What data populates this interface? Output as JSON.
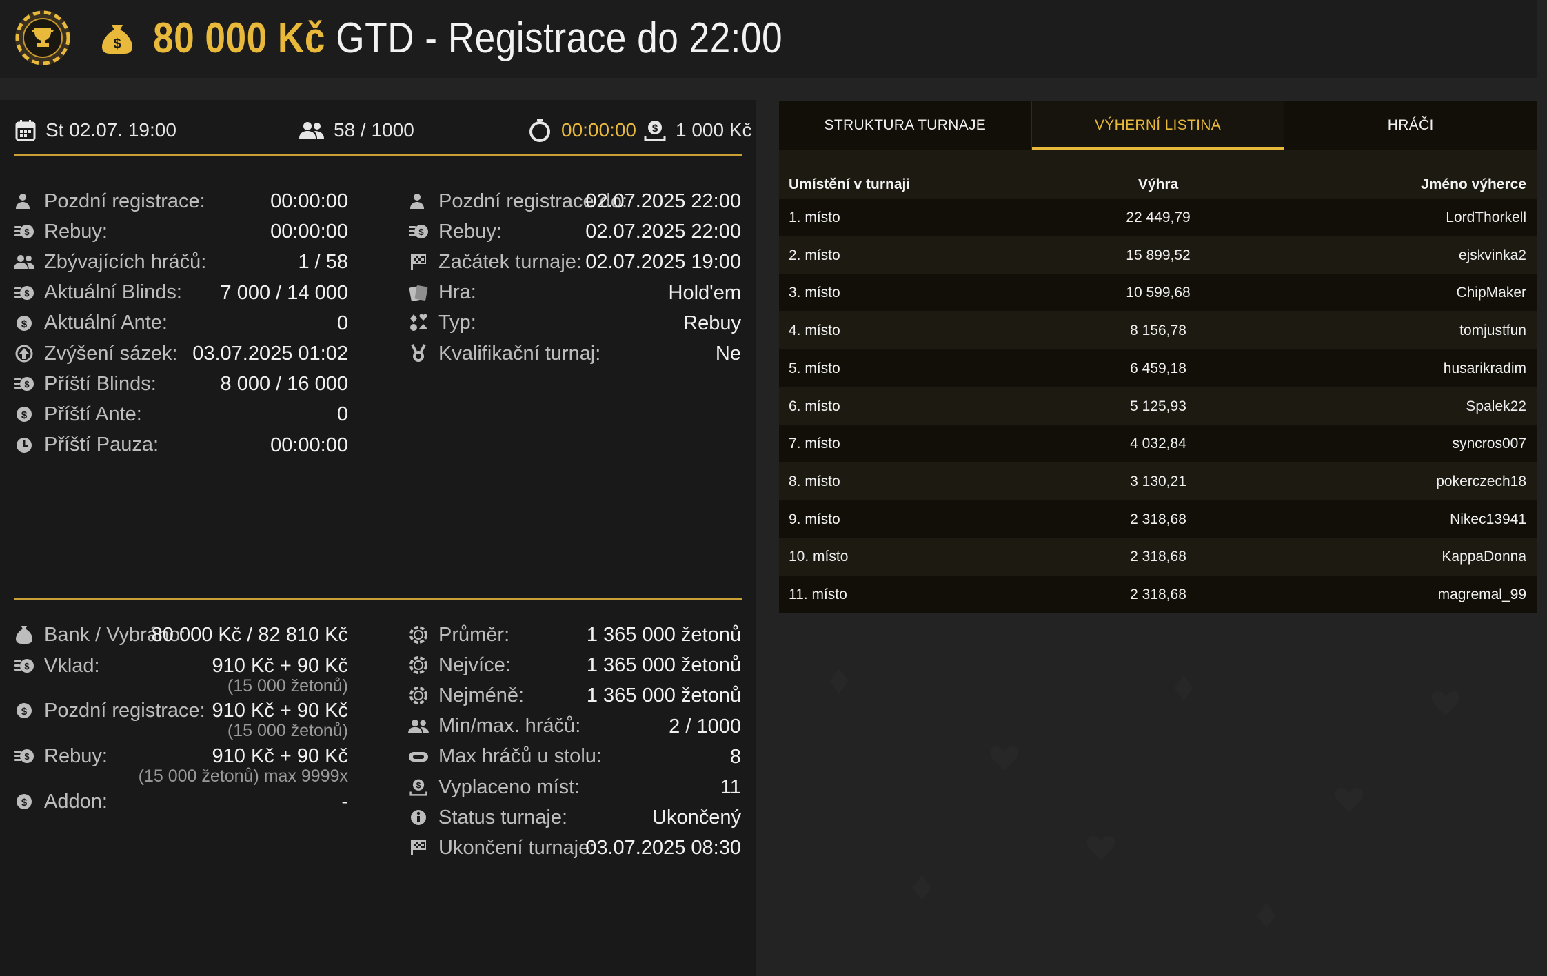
{
  "header": {
    "amount": "80 000 Kč",
    "title_rest": "GTD - Registrace do 22:00"
  },
  "summary": {
    "date": "St 02.07. 19:00",
    "players": "58 / 1000",
    "timer": "00:00:00",
    "buyin": "1 000 Kč"
  },
  "left_col": [
    {
      "icon": "user-clock-icon",
      "label": "Pozdní registrace:",
      "value": "00:00:00"
    },
    {
      "icon": "coins-icon",
      "label": "Rebuy:",
      "value": "00:00:00"
    },
    {
      "icon": "users-icon",
      "label": "Zbývajících hráčů:",
      "value": "1 / 58"
    },
    {
      "icon": "coins-icon",
      "label": "Aktuální Blinds:",
      "value": "7 000 / 14 000"
    },
    {
      "icon": "dollar-coin-icon",
      "label": "Aktuální Ante:",
      "value": "0"
    },
    {
      "icon": "arrow-up-circle-icon",
      "label": "Zvýšení sázek:",
      "value": "03.07.2025 01:02"
    },
    {
      "icon": "coins-icon",
      "label": "Příští Blinds:",
      "value": "8 000 / 16 000"
    },
    {
      "icon": "dollar-coin-icon",
      "label": "Příští Ante:",
      "value": "0"
    },
    {
      "icon": "clock-icon",
      "label": "Příští Pauza:",
      "value": "00:00:00"
    }
  ],
  "right_col": [
    {
      "icon": "user-clock-icon",
      "label": "Pozdní registrace do:",
      "value": "02.07.2025 22:00"
    },
    {
      "icon": "coins-icon",
      "label": "Rebuy:",
      "value": "02.07.2025 22:00"
    },
    {
      "icon": "flag-icon",
      "label": "Začátek turnaje:",
      "value": "02.07.2025 19:00"
    },
    {
      "icon": "cards-icon",
      "label": "Hra:",
      "value": "Hold'em"
    },
    {
      "icon": "suits-icon",
      "label": "Typ:",
      "value": "Rebuy"
    },
    {
      "icon": "medal-icon",
      "label": "Kvalifikační turnaj:",
      "value": "Ne"
    }
  ],
  "bank": {
    "label": "Bank / Vybráno:",
    "value": "80 000 Kč / 82 810 Kč"
  },
  "fees": [
    {
      "icon": "coins-icon",
      "label": "Vklad:",
      "value": "910 Kč + 90 Kč",
      "sub": "(15 000 žetonů)"
    },
    {
      "icon": "dollar-coin-icon",
      "label": "Pozdní registrace:",
      "value": "910 Kč + 90 Kč",
      "sub": "(15 000 žetonů)"
    },
    {
      "icon": "coins-icon",
      "label": "Rebuy:",
      "value": "910 Kč + 90 Kč",
      "sub": "(15 000 žetonů) max 9999x"
    },
    {
      "icon": "dollar-coin-icon",
      "label": "Addon:",
      "value": "-",
      "sub": ""
    }
  ],
  "stats": [
    {
      "icon": "chip-icon",
      "label": "Průměr:",
      "value": "1 365 000 žetonů"
    },
    {
      "icon": "chip-icon",
      "label": "Nejvíce:",
      "value": "1 365 000 žetonů"
    },
    {
      "icon": "chip-icon",
      "label": "Nejméně:",
      "value": "1 365 000 žetonů"
    },
    {
      "icon": "users-icon",
      "label": "Min/max. hráčů:",
      "value": "2 / 1000"
    },
    {
      "icon": "table-icon",
      "label": "Max hráčů u stolu:",
      "value": "8"
    },
    {
      "icon": "payout-icon",
      "label": "Vyplaceno míst:",
      "value": "11"
    },
    {
      "icon": "info-icon",
      "label": "Status turnaje:",
      "value": "Ukončený"
    },
    {
      "icon": "flag-icon",
      "label": "Ukončení turnaje:",
      "value": "03.07.2025 08:30"
    }
  ],
  "tabs": [
    "STRUKTURA TURNAJE",
    "VÝHERNÍ LISTINA",
    "HRÁČI"
  ],
  "payouts": {
    "headers": [
      "Umístění v turnaji",
      "Výhra",
      "Jméno výherce"
    ],
    "rows": [
      [
        "1. místo",
        "22 449,79",
        "LordThorkell"
      ],
      [
        "2. místo",
        "15 899,52",
        "ejskvinka2"
      ],
      [
        "3. místo",
        "10 599,68",
        "ChipMaker"
      ],
      [
        "4. místo",
        "8 156,78",
        "tomjustfun"
      ],
      [
        "5. místo",
        "6 459,18",
        "husarikradim"
      ],
      [
        "6. místo",
        "5 125,93",
        "Spalek22"
      ],
      [
        "7. místo",
        "4 032,84",
        "syncros007"
      ],
      [
        "8. místo",
        "3 130,21",
        "pokerczech18"
      ],
      [
        "9. místo",
        "2 318,68",
        "Nikec13941"
      ],
      [
        "10. místo",
        "2 318,68",
        "KappaDonna"
      ],
      [
        "11. místo",
        "2 318,68",
        "magremal_99"
      ]
    ]
  },
  "colors": {
    "accent": "#e8b93a",
    "bg": "#232323",
    "panel": "#191919"
  }
}
